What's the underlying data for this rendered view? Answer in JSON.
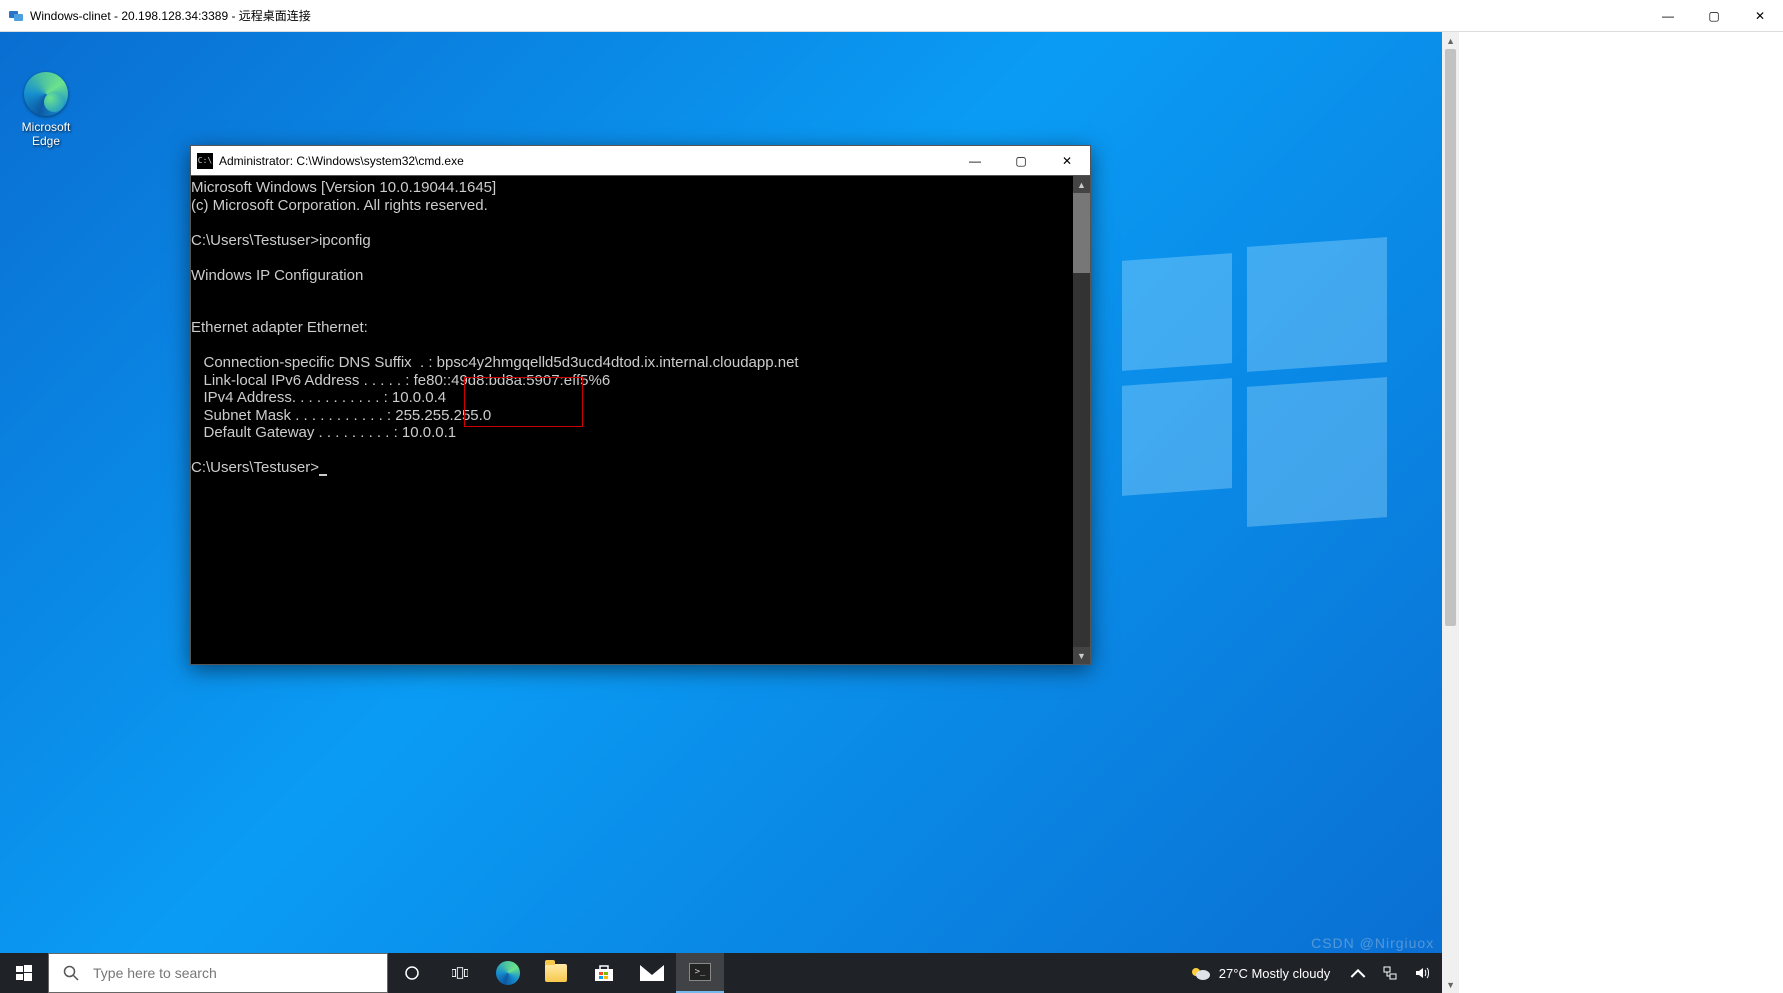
{
  "host": {
    "title": "Windows-clinet - 20.198.128.34:3389 - 远程桌面连接",
    "controls": {
      "min": "—",
      "max": "▢",
      "close": "✕"
    }
  },
  "desktop": {
    "edge_label_line1": "Microsoft",
    "edge_label_line2": "Edge"
  },
  "cmd": {
    "title": "Administrator: C:\\Windows\\system32\\cmd.exe",
    "controls": {
      "min": "—",
      "max": "▢",
      "close": "✕"
    },
    "lines": {
      "l1": "Microsoft Windows [Version 10.0.19044.1645]",
      "l2": "(c) Microsoft Corporation. All rights reserved.",
      "l3": "",
      "l4": "C:\\Users\\Testuser>ipconfig",
      "l5": "",
      "l6": "Windows IP Configuration",
      "l7": "",
      "l8": "",
      "l9": "Ethernet adapter Ethernet:",
      "l10": "",
      "l11": "   Connection-specific DNS Suffix  . : bpsc4y2hmgqelld5d3ucd4dtod.ix.internal.cloudapp.net",
      "l12": "   Link-local IPv6 Address . . . . . : fe80::49d8:bd8a:5907:eff5%6",
      "l13": "   IPv4 Address. . . . . . . . . . . : 10.0.0.4",
      "l14": "   Subnet Mask . . . . . . . . . . . : 255.255.255.0",
      "l15": "   Default Gateway . . . . . . . . . : 10.0.0.1",
      "l16": "",
      "l17": "C:\\Users\\Testuser>"
    }
  },
  "taskbar": {
    "search_placeholder": "Type here to search",
    "weather": "27°C  Mostly cloudy"
  },
  "watermark": "CSDN @Nirgiuox"
}
